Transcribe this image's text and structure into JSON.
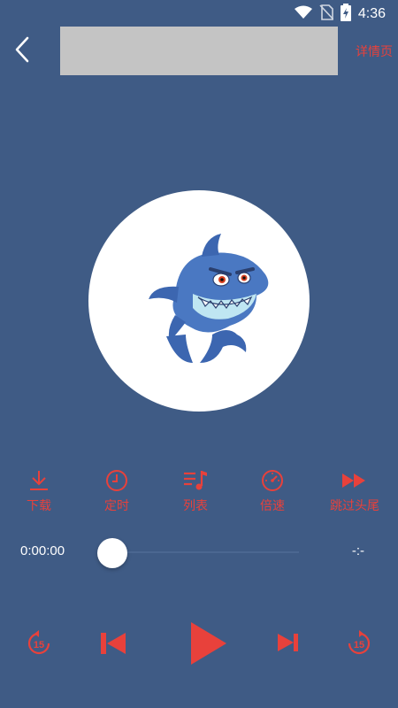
{
  "status_bar": {
    "time": "4:36"
  },
  "header": {
    "detail_link": "详情页"
  },
  "actions": [
    {
      "label": "下载",
      "icon": "download-icon"
    },
    {
      "label": "定时",
      "icon": "timer-icon"
    },
    {
      "label": "列表",
      "icon": "playlist-icon"
    },
    {
      "label": "倍速",
      "icon": "speed-icon"
    },
    {
      "label": "跳过头尾",
      "icon": "skip-intro-outro-icon"
    }
  ],
  "progress": {
    "current_time": "0:00:00",
    "total_time": "-:-",
    "fraction": 0
  },
  "controls": {
    "rewind_seconds": "15",
    "forward_seconds": "15"
  },
  "colors": {
    "accent": "#e8413b",
    "background": "#3f5b85",
    "title_placeholder": "#c4c4c4"
  }
}
